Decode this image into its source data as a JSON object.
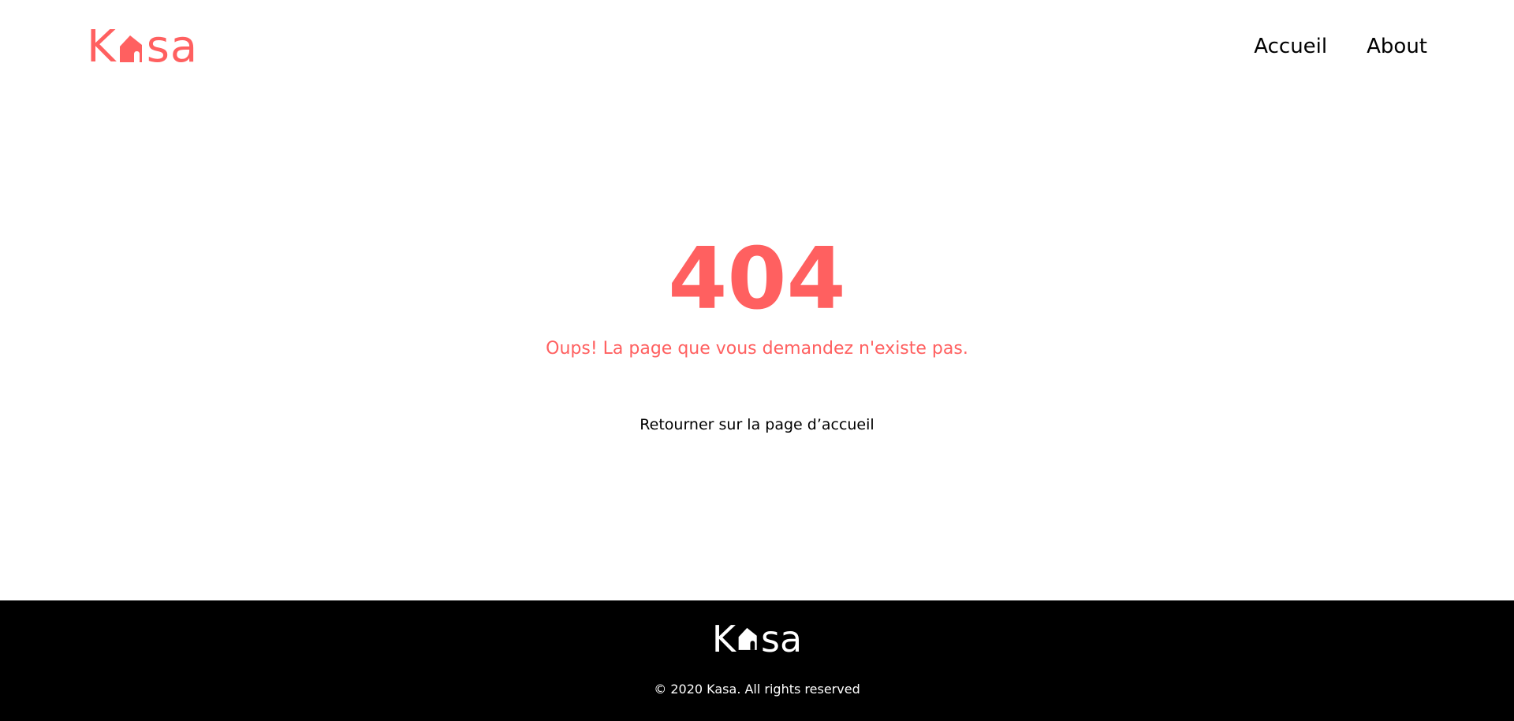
{
  "brand": {
    "logo_k": "K",
    "logo_sa": "sa",
    "accent_color": "#FF6060"
  },
  "nav": {
    "items": [
      {
        "label": "Accueil"
      },
      {
        "label": "About"
      }
    ]
  },
  "error": {
    "code": "404",
    "message": "Oups! La page que vous demandez n'existe pas.",
    "back_link": "Retourner sur la page d’accueil"
  },
  "footer": {
    "logo_k": "K",
    "logo_sa": "sa",
    "copyright": "© 2020 Kasa. All rights reserved",
    "background": "#000000",
    "text_color": "#FFFFFF"
  },
  "icons": {
    "logo_house": "house-icon"
  }
}
